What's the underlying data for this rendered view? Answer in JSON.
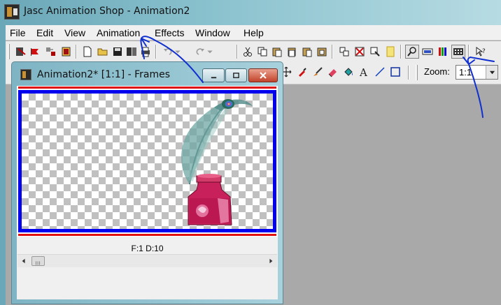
{
  "app": {
    "title": "Jasc Animation Shop - Animation2"
  },
  "menubar": {
    "items": [
      {
        "label": "File"
      },
      {
        "label": "Edit"
      },
      {
        "label": "View"
      },
      {
        "label": "Animation"
      },
      {
        "label": "Effects"
      },
      {
        "label": "Window"
      },
      {
        "label": "Help"
      }
    ]
  },
  "toolbar": {
    "zoom_label": "Zoom:",
    "zoom_value": "1:1"
  },
  "frames_window": {
    "title": "Animation2* [1:1] - Frames",
    "frame_info": "F:1  D:10"
  },
  "colors": {
    "frame_border": "#0000ee",
    "frame_line": "#e01010",
    "annotation_ink": "#1030d0"
  }
}
